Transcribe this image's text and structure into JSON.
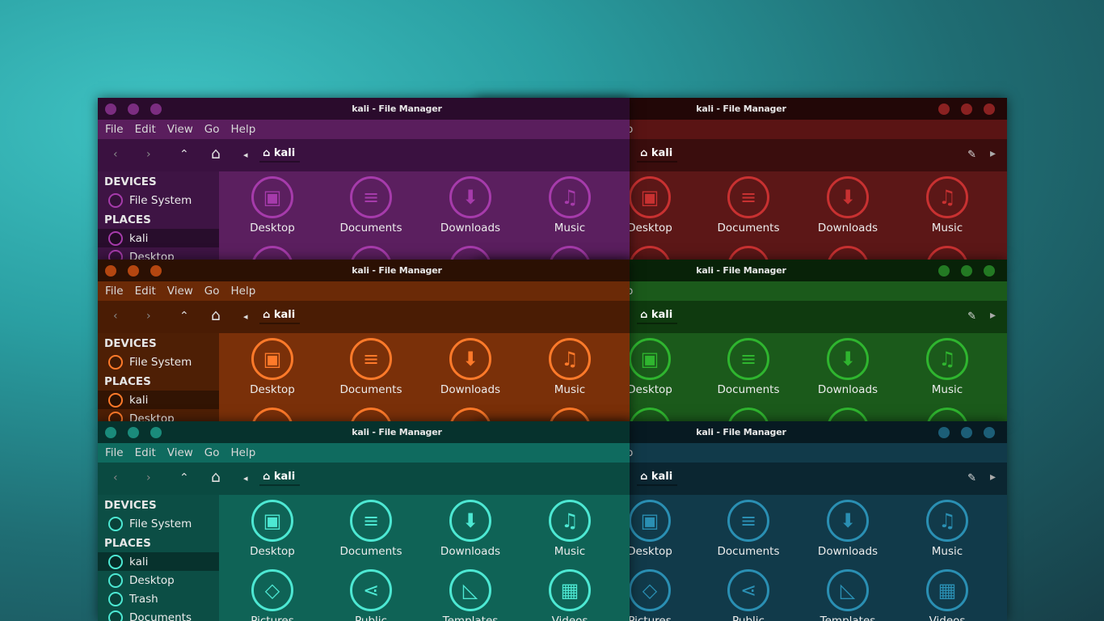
{
  "window_title": "kali - File Manager",
  "menu": [
    "File",
    "Edit",
    "View",
    "Go",
    "Help"
  ],
  "path_label": "kali",
  "sidebar": {
    "devices_header": "DEVICES",
    "places_header": "PLACES",
    "items": [
      "File System",
      "kali",
      "Desktop",
      "Trash",
      "Documents"
    ]
  },
  "icons": [
    "Desktop",
    "Documents",
    "Downloads",
    "Music"
  ],
  "bottom_icons": [
    "Pictures",
    "Public",
    "Templates",
    "Videos"
  ],
  "themes": {
    "purple": {
      "titlebar": "#2a0b2c",
      "menubar": "#5a1e5d",
      "toolbar": "#3a1140",
      "side": "#3e1444",
      "main": "#5b1f5f",
      "accent": "#a63bab",
      "dot": "#7b2d80"
    },
    "red": {
      "titlebar": "#220707",
      "menubar": "#5a1414",
      "toolbar": "#3a0d0d",
      "side": "#3f0f0f",
      "main": "#5c1717",
      "accent": "#c83131",
      "dot": "#8a2121"
    },
    "orange": {
      "titlebar": "#2b1003",
      "menubar": "#6b2a07",
      "toolbar": "#4a1c04",
      "side": "#4e1f05",
      "main": "#7a3009",
      "accent": "#ff7a2a",
      "dot": "#b44610"
    },
    "green": {
      "titlebar": "#082208",
      "menubar": "#1b5a1b",
      "toolbar": "#0f3a0f",
      "side": "#123f12",
      "main": "#1b5a1b",
      "accent": "#2fb52f",
      "dot": "#237a23"
    },
    "teal": {
      "titlebar": "#06322d",
      "menubar": "#0f6b5f",
      "toolbar": "#0a4a41",
      "side": "#0c4e45",
      "main": "#0f6356",
      "accent": "#4de8d3",
      "dot": "#1a8b7b"
    },
    "blue": {
      "titlebar": "#071a22",
      "menubar": "#113a4a",
      "toolbar": "#0b2631",
      "side": "#0d2b37",
      "main": "#113a4a",
      "accent": "#2a8fb3",
      "dot": "#1c5e77"
    }
  }
}
